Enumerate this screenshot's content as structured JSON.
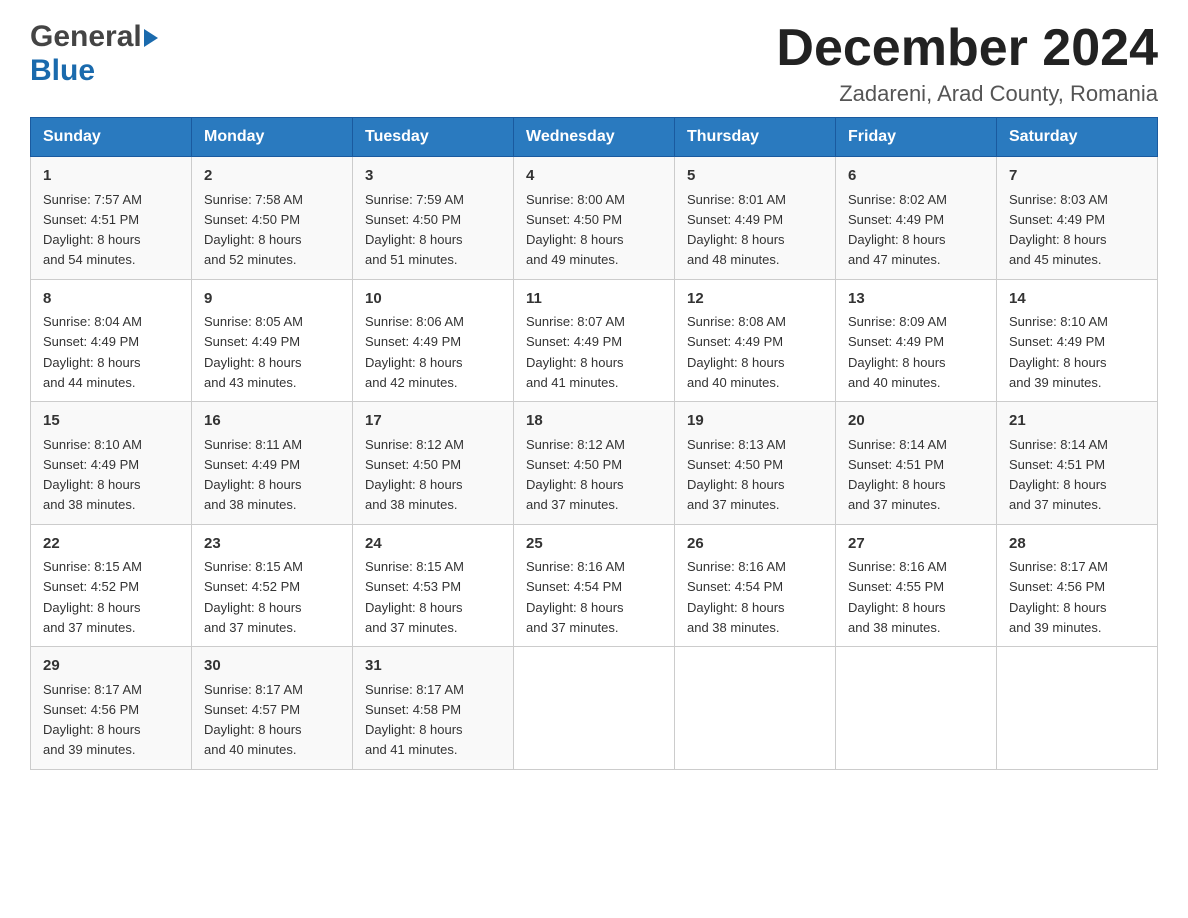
{
  "header": {
    "logo_general": "General",
    "logo_blue": "Blue",
    "month_title": "December 2024",
    "location": "Zadareni, Arad County, Romania"
  },
  "days_of_week": [
    "Sunday",
    "Monday",
    "Tuesday",
    "Wednesday",
    "Thursday",
    "Friday",
    "Saturday"
  ],
  "weeks": [
    [
      {
        "day": "1",
        "sunrise": "7:57 AM",
        "sunset": "4:51 PM",
        "daylight": "8 hours and 54 minutes."
      },
      {
        "day": "2",
        "sunrise": "7:58 AM",
        "sunset": "4:50 PM",
        "daylight": "8 hours and 52 minutes."
      },
      {
        "day": "3",
        "sunrise": "7:59 AM",
        "sunset": "4:50 PM",
        "daylight": "8 hours and 51 minutes."
      },
      {
        "day": "4",
        "sunrise": "8:00 AM",
        "sunset": "4:50 PM",
        "daylight": "8 hours and 49 minutes."
      },
      {
        "day": "5",
        "sunrise": "8:01 AM",
        "sunset": "4:49 PM",
        "daylight": "8 hours and 48 minutes."
      },
      {
        "day": "6",
        "sunrise": "8:02 AM",
        "sunset": "4:49 PM",
        "daylight": "8 hours and 47 minutes."
      },
      {
        "day": "7",
        "sunrise": "8:03 AM",
        "sunset": "4:49 PM",
        "daylight": "8 hours and 45 minutes."
      }
    ],
    [
      {
        "day": "8",
        "sunrise": "8:04 AM",
        "sunset": "4:49 PM",
        "daylight": "8 hours and 44 minutes."
      },
      {
        "day": "9",
        "sunrise": "8:05 AM",
        "sunset": "4:49 PM",
        "daylight": "8 hours and 43 minutes."
      },
      {
        "day": "10",
        "sunrise": "8:06 AM",
        "sunset": "4:49 PM",
        "daylight": "8 hours and 42 minutes."
      },
      {
        "day": "11",
        "sunrise": "8:07 AM",
        "sunset": "4:49 PM",
        "daylight": "8 hours and 41 minutes."
      },
      {
        "day": "12",
        "sunrise": "8:08 AM",
        "sunset": "4:49 PM",
        "daylight": "8 hours and 40 minutes."
      },
      {
        "day": "13",
        "sunrise": "8:09 AM",
        "sunset": "4:49 PM",
        "daylight": "8 hours and 40 minutes."
      },
      {
        "day": "14",
        "sunrise": "8:10 AM",
        "sunset": "4:49 PM",
        "daylight": "8 hours and 39 minutes."
      }
    ],
    [
      {
        "day": "15",
        "sunrise": "8:10 AM",
        "sunset": "4:49 PM",
        "daylight": "8 hours and 38 minutes."
      },
      {
        "day": "16",
        "sunrise": "8:11 AM",
        "sunset": "4:49 PM",
        "daylight": "8 hours and 38 minutes."
      },
      {
        "day": "17",
        "sunrise": "8:12 AM",
        "sunset": "4:50 PM",
        "daylight": "8 hours and 38 minutes."
      },
      {
        "day": "18",
        "sunrise": "8:12 AM",
        "sunset": "4:50 PM",
        "daylight": "8 hours and 37 minutes."
      },
      {
        "day": "19",
        "sunrise": "8:13 AM",
        "sunset": "4:50 PM",
        "daylight": "8 hours and 37 minutes."
      },
      {
        "day": "20",
        "sunrise": "8:14 AM",
        "sunset": "4:51 PM",
        "daylight": "8 hours and 37 minutes."
      },
      {
        "day": "21",
        "sunrise": "8:14 AM",
        "sunset": "4:51 PM",
        "daylight": "8 hours and 37 minutes."
      }
    ],
    [
      {
        "day": "22",
        "sunrise": "8:15 AM",
        "sunset": "4:52 PM",
        "daylight": "8 hours and 37 minutes."
      },
      {
        "day": "23",
        "sunrise": "8:15 AM",
        "sunset": "4:52 PM",
        "daylight": "8 hours and 37 minutes."
      },
      {
        "day": "24",
        "sunrise": "8:15 AM",
        "sunset": "4:53 PM",
        "daylight": "8 hours and 37 minutes."
      },
      {
        "day": "25",
        "sunrise": "8:16 AM",
        "sunset": "4:54 PM",
        "daylight": "8 hours and 37 minutes."
      },
      {
        "day": "26",
        "sunrise": "8:16 AM",
        "sunset": "4:54 PM",
        "daylight": "8 hours and 38 minutes."
      },
      {
        "day": "27",
        "sunrise": "8:16 AM",
        "sunset": "4:55 PM",
        "daylight": "8 hours and 38 minutes."
      },
      {
        "day": "28",
        "sunrise": "8:17 AM",
        "sunset": "4:56 PM",
        "daylight": "8 hours and 39 minutes."
      }
    ],
    [
      {
        "day": "29",
        "sunrise": "8:17 AM",
        "sunset": "4:56 PM",
        "daylight": "8 hours and 39 minutes."
      },
      {
        "day": "30",
        "sunrise": "8:17 AM",
        "sunset": "4:57 PM",
        "daylight": "8 hours and 40 minutes."
      },
      {
        "day": "31",
        "sunrise": "8:17 AM",
        "sunset": "4:58 PM",
        "daylight": "8 hours and 41 minutes."
      },
      null,
      null,
      null,
      null
    ]
  ],
  "labels": {
    "sunrise": "Sunrise:",
    "sunset": "Sunset:",
    "daylight": "Daylight:"
  }
}
